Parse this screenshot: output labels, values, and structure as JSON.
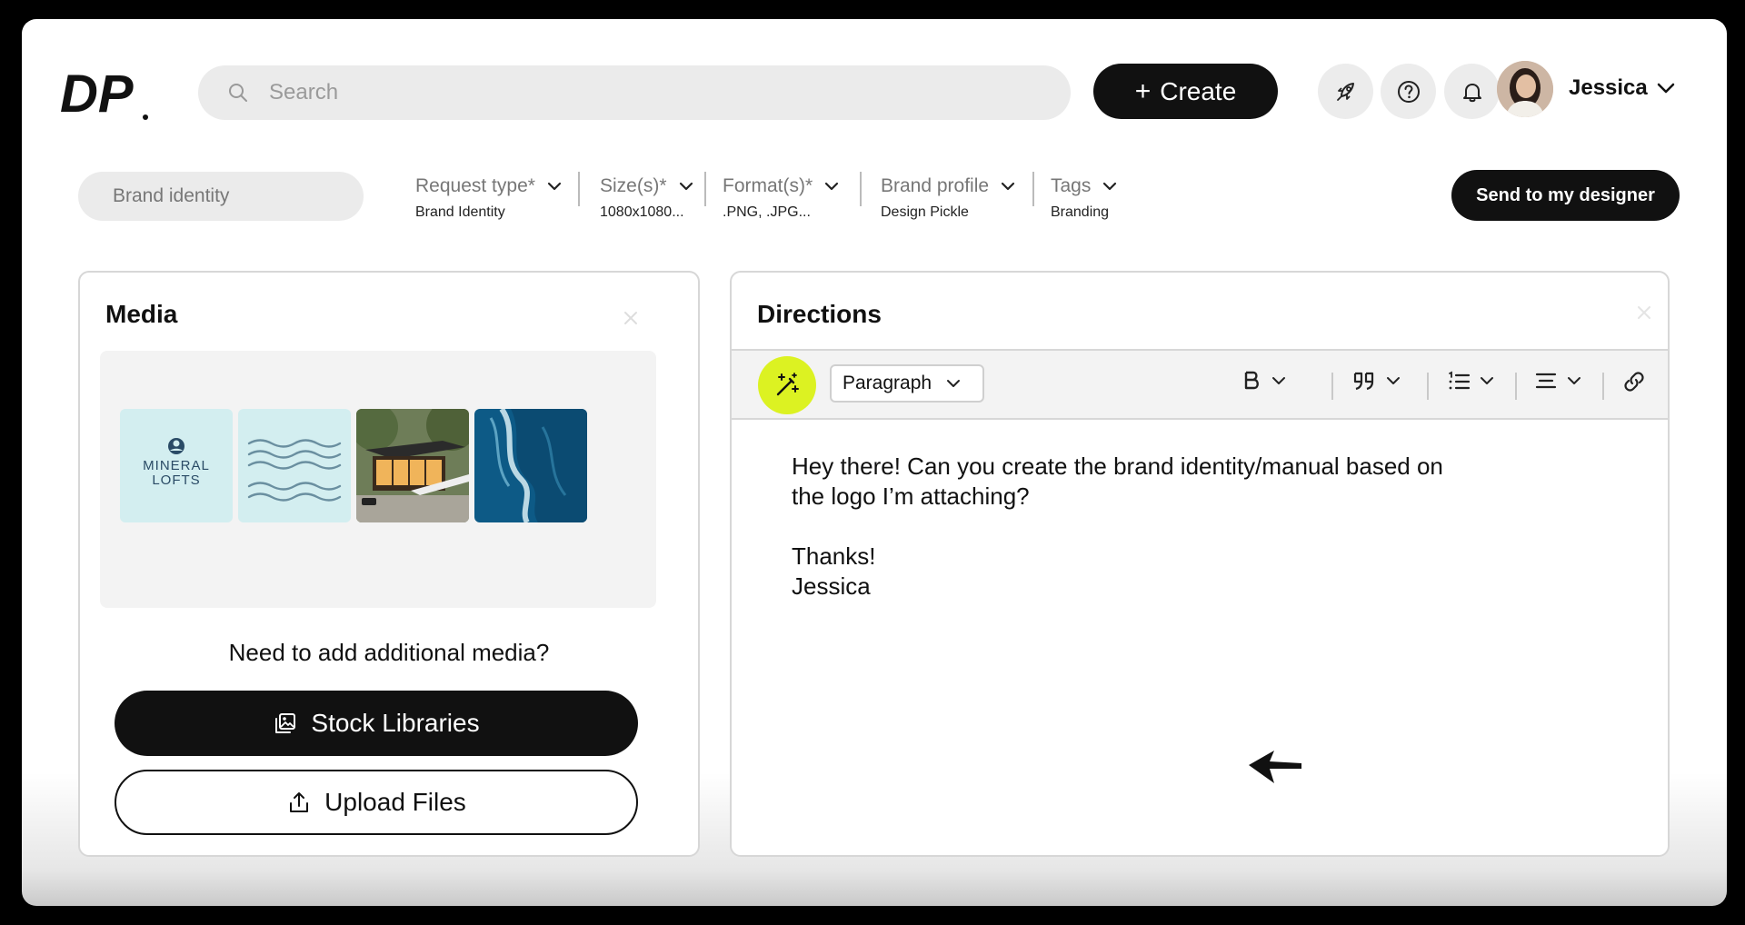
{
  "header": {
    "logo_text": "DP",
    "search_placeholder": "Search",
    "create_label": "Create",
    "user_name": "Jessica",
    "icons": [
      "rocket-icon",
      "help-icon",
      "bell-icon"
    ]
  },
  "request": {
    "title_placeholder": "Brand identity",
    "filters": [
      {
        "label": "Request type*",
        "value": "Brand Identity"
      },
      {
        "label": "Size(s)*",
        "value": "1080x1080..."
      },
      {
        "label": "Format(s)*",
        "value": ".PNG, .JPG..."
      },
      {
        "label": "Brand profile",
        "value": "Design Pickle"
      },
      {
        "label": "Tags",
        "value": "Branding"
      }
    ],
    "send_label": "Send to my designer"
  },
  "media": {
    "title": "Media",
    "logo_line1": "MINERAL",
    "logo_line2": "LOFTS",
    "need_text": "Need to add additional media?",
    "stock_label": "Stock Libraries",
    "upload_label": "Upload Files"
  },
  "directions": {
    "title": "Directions",
    "paragraph_style": "Paragraph",
    "text_line1": "Hey there! Can you create the brand identity/manual based on",
    "text_line2": "the logo I’m attaching?",
    "text_line3": "Thanks!",
    "text_line4": "Jessica"
  },
  "colors": {
    "accent": "#dcf222",
    "primary": "#111111",
    "surface": "#ebebeb"
  }
}
